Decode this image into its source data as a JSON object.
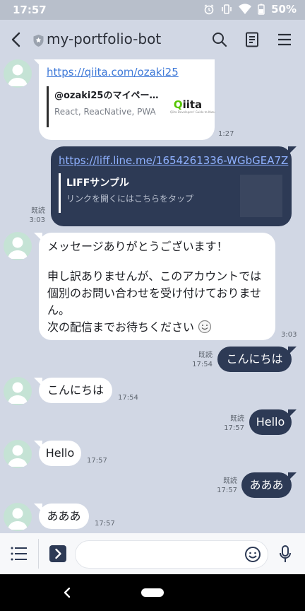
{
  "status": {
    "time": "17:57",
    "battery": "50%"
  },
  "header": {
    "title": "my-portfolio-bot"
  },
  "messages": {
    "m1": {
      "url": "https://qiita.com/ozaki25",
      "card_title": "@ozaki25のマイペー…",
      "card_desc": "React, ReacNative, PWA",
      "card_logo": "Qiita",
      "card_logo_tag": "Qiita Developers' Guide to Kazu",
      "time": "1:27"
    },
    "m2": {
      "url": "https://liff.line.me/1654261336-WGbGEA7Z",
      "card_title": "LIFFサンプル",
      "card_desc": "リンクを開くにはこちらをタップ",
      "read": "既読",
      "time": "3:03"
    },
    "m3": {
      "line1": "メッセージありがとうございます！",
      "line2": "申し訳ありませんが、このアカウントでは",
      "line3": "個別のお問い合わせを受け付けておりませ",
      "line4": "ん。",
      "line5": "次の配信までお待ちください",
      "time": "3:03"
    },
    "m4": {
      "text": "こんにちは",
      "read": "既読",
      "time": "17:54"
    },
    "m5": {
      "text": "こんにちは",
      "time": "17:54"
    },
    "m6": {
      "text": "Hello",
      "read": "既読",
      "time": "17:57"
    },
    "m7": {
      "text": "Hello",
      "time": "17:57"
    },
    "m8": {
      "text": "あああ",
      "read": "既読",
      "time": "17:57"
    },
    "m9": {
      "text": "あああ",
      "time": "17:57"
    }
  },
  "colors": {
    "outgoing": "#2d3a55",
    "incoming": "#ffffff",
    "background": "#d1d7e4",
    "link": "#3e79d8",
    "out_link": "#8fb1ff"
  }
}
